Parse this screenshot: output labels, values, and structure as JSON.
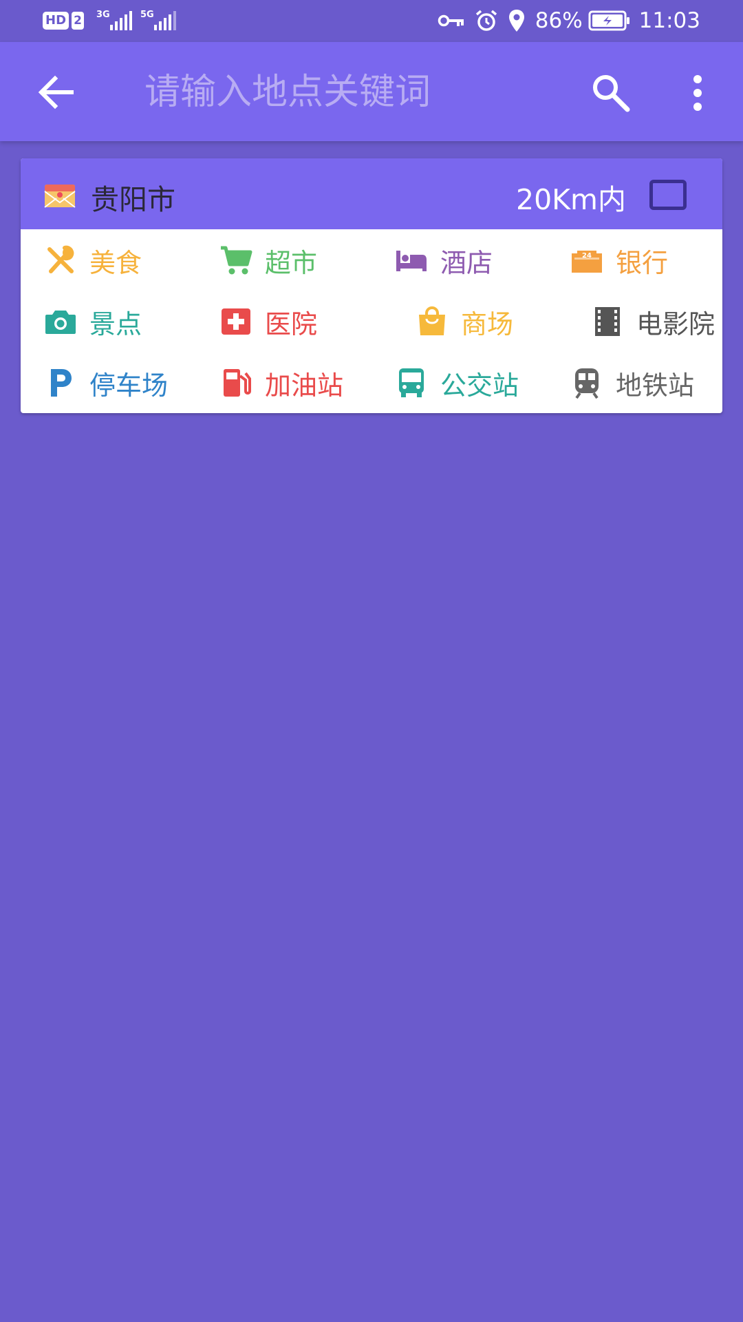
{
  "status_bar": {
    "hd": "HD",
    "sim": "2",
    "net1": "3G",
    "net2": "5G",
    "battery": "86%",
    "time": "11:03",
    "icons": [
      "key-icon",
      "alarm-icon",
      "location-icon",
      "battery-charging-icon"
    ]
  },
  "app_bar": {
    "search_placeholder": "请输入地点关键词",
    "search_value": "",
    "icons": [
      "back-arrow-icon",
      "search-icon",
      "more-vert-icon"
    ]
  },
  "filter": {
    "city": "贵阳市",
    "range": "20Km内",
    "range_checked": false
  },
  "categories": [
    {
      "label": "美食",
      "icon": "fork-spoon-icon",
      "color": "#f6b23c"
    },
    {
      "label": "超市",
      "icon": "cart-icon",
      "color": "#5bbf6a"
    },
    {
      "label": "酒店",
      "icon": "bed-icon",
      "color": "#8e5bb0"
    },
    {
      "label": "银行",
      "icon": "bank-24h-icon",
      "color": "#f4a040"
    },
    {
      "label": "景点",
      "icon": "camera-icon",
      "color": "#2aa99a"
    },
    {
      "label": "医院",
      "icon": "hospital-cross-icon",
      "color": "#e94b4b"
    },
    {
      "label": "商场",
      "icon": "shopping-bag-icon",
      "color": "#f6b93b"
    },
    {
      "label": "电影院",
      "icon": "film-icon",
      "color": "#555555"
    },
    {
      "label": "停车场",
      "icon": "parking-icon",
      "color": "#2f83c9"
    },
    {
      "label": "加油站",
      "icon": "gas-station-icon",
      "color": "#e94b4b"
    },
    {
      "label": "公交站",
      "icon": "bus-icon",
      "color": "#2aa99a"
    },
    {
      "label": "地铁站",
      "icon": "subway-icon",
      "color": "#666666"
    }
  ],
  "colors": {
    "status_bar_bg": "#6a5acc",
    "app_bar_bg": "#7a67ee",
    "page_bg": "#6b5bcc",
    "card_bg": "#ffffff"
  }
}
